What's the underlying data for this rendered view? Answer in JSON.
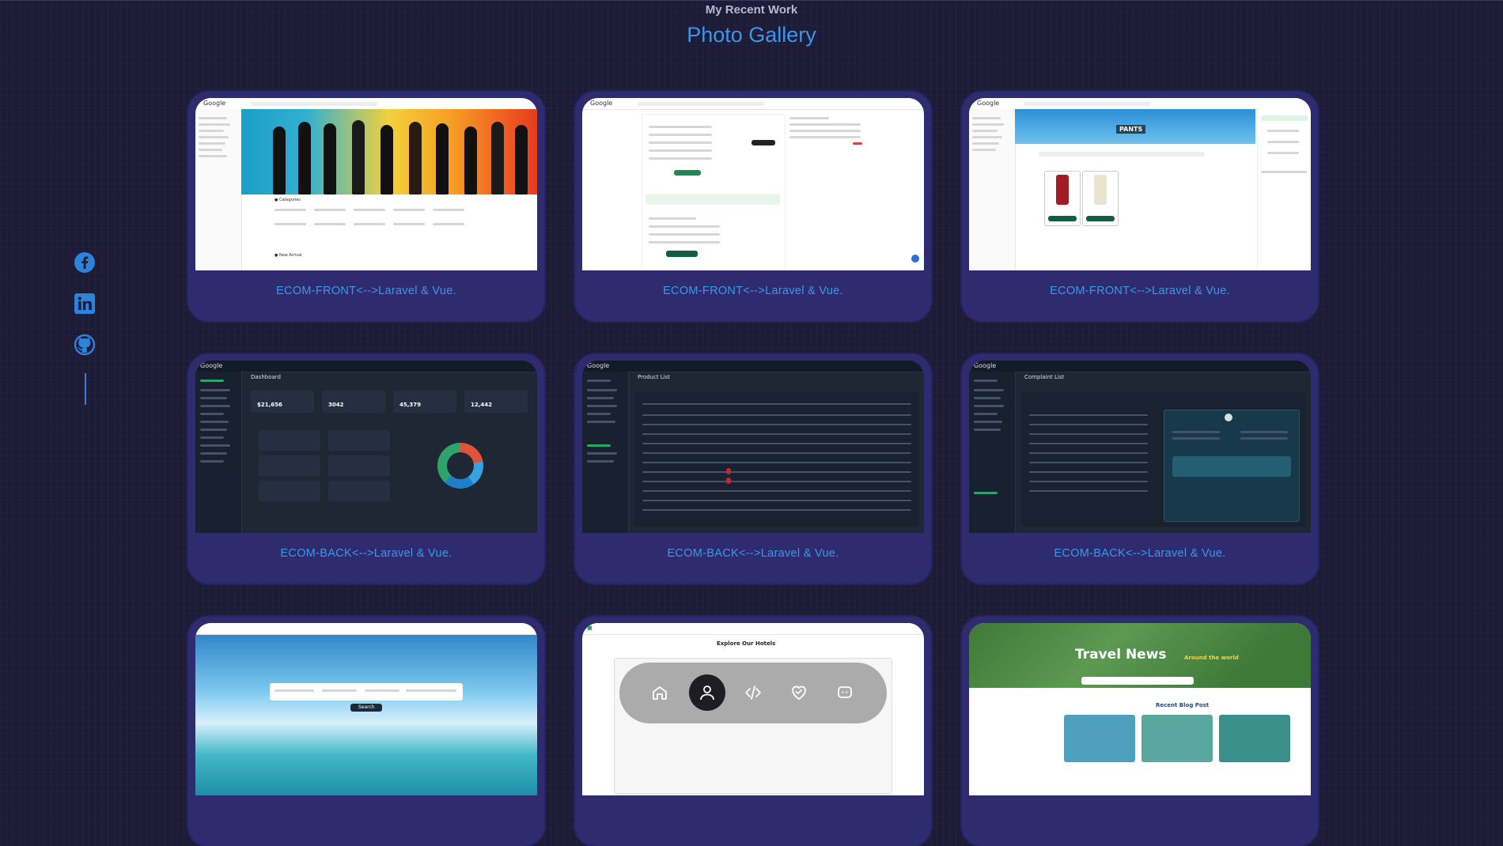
{
  "section": {
    "subtitle": "My Recent Work",
    "title": "Photo Gallery"
  },
  "social": {
    "items": [
      {
        "name": "facebook-icon"
      },
      {
        "name": "linkedin-icon"
      },
      {
        "name": "github-icon"
      }
    ],
    "color": "#2d83d9"
  },
  "gallery": {
    "cards": [
      {
        "caption": "ECOM-FRONT<-->Laravel & Vue."
      },
      {
        "caption": "ECOM-FRONT<-->Laravel & Vue."
      },
      {
        "caption": "ECOM-FRONT<-->Laravel & Vue."
      },
      {
        "caption": "ECOM-BACK<-->Laravel & Vue."
      },
      {
        "caption": "ECOM-BACK<-->Laravel & Vue."
      },
      {
        "caption": "ECOM-BACK<-->Laravel & Vue."
      }
    ],
    "preview_text": {
      "pants": "PANTS",
      "dashboard": "Dashboard",
      "product_list": "Product List",
      "complaint_list": "Complaint List",
      "explore_hotels": "Explore Our Hotels",
      "travel_news": "Travel News",
      "around_world": "Around the world",
      "recent_blog": "Recent Blog Post",
      "search": "Search",
      "total_sales": "$21,656",
      "total_orders": "3042",
      "total_customer": "45,379",
      "total_product": "12,442"
    }
  },
  "dock": {
    "items": [
      {
        "name": "home-icon",
        "active": false
      },
      {
        "name": "user-icon",
        "active": true
      },
      {
        "name": "code-icon",
        "active": false
      },
      {
        "name": "heart-handshake-icon",
        "active": false
      },
      {
        "name": "chat-icon",
        "active": false
      }
    ]
  },
  "colors": {
    "background": "#1d1b36",
    "card": "#2e2c6e",
    "accent": "#3a97ec"
  }
}
